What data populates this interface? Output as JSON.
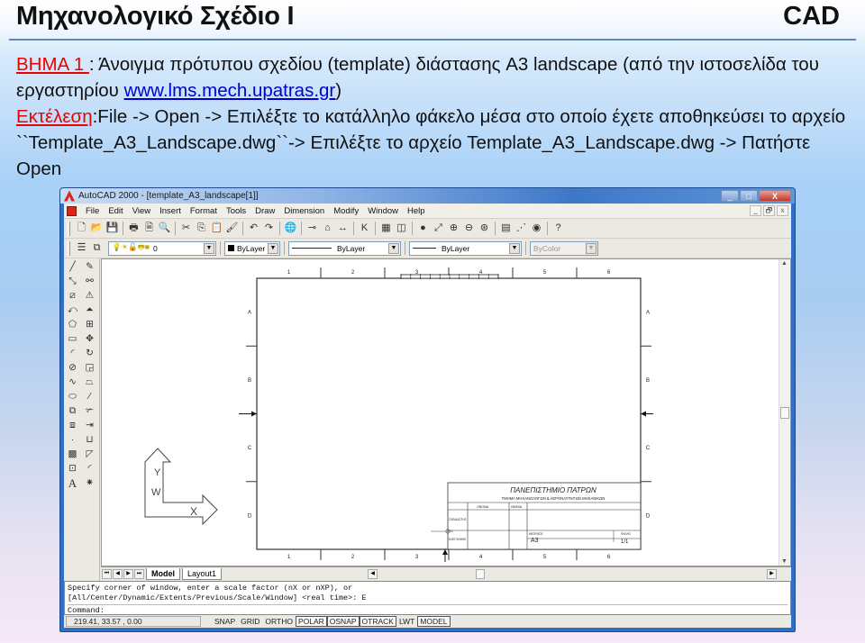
{
  "slide": {
    "title": "Μηχανολογικό Σχέδιο  Ι",
    "tag": "CAD",
    "step_label": "ΒΗΜΑ 1 ",
    "step_text": ": Άνοιγμα πρότυπου σχεδίου (template) διάστασης A3 landscape (από την ιστοσελίδα του εργαστηρίου ",
    "link": "www.lms.mech.upatras.gr",
    "step_close": ")",
    "exec_label": "Εκτέλεση",
    "exec_text": ":File -> Open -> Επιλέξτε το κατάλληλο φάκελο μέσα στο οποίο έχετε αποθηκεύσει το αρχείο ``Template_A3_Landscape.dwg``-> Επιλέξτε το αρχείο Template_A3_Landscape.dwg  -> Πατήστε  Open"
  },
  "window": {
    "title": "AutoCAD 2000 - [template_A3_landscape[1]]",
    "controls": {
      "minimize": "_",
      "maximize": "□",
      "close": "X"
    },
    "doc_controls": {
      "minimize": "_",
      "restore": "🗗",
      "close": "x"
    }
  },
  "menu": [
    "File",
    "Edit",
    "View",
    "Insert",
    "Format",
    "Tools",
    "Draw",
    "Dimension",
    "Modify",
    "Window",
    "Help"
  ],
  "standard_toolbar": [
    {
      "icon": "new-icon",
      "glyph": "🗋"
    },
    {
      "icon": "open-icon",
      "glyph": "📂"
    },
    {
      "icon": "save-icon",
      "glyph": "💾"
    },
    {
      "sep": true
    },
    {
      "icon": "print-icon",
      "glyph": "🖶"
    },
    {
      "icon": "print-preview-icon",
      "glyph": "🗎"
    },
    {
      "icon": "find-icon",
      "glyph": "🔍"
    },
    {
      "sep": true
    },
    {
      "icon": "cut-icon",
      "glyph": "✂"
    },
    {
      "icon": "copy-icon",
      "glyph": "⎘"
    },
    {
      "icon": "paste-icon",
      "glyph": "📋"
    },
    {
      "icon": "match-properties-icon",
      "glyph": "🖌"
    },
    {
      "sep": true
    },
    {
      "icon": "undo-icon",
      "glyph": "↶"
    },
    {
      "icon": "redo-icon",
      "glyph": "↷"
    },
    {
      "sep": true
    },
    {
      "icon": "web-icon",
      "glyph": "🌐"
    },
    {
      "sep": true
    },
    {
      "icon": "object-snap-icon",
      "glyph": "⊸"
    },
    {
      "icon": "ucs-icon",
      "glyph": "⌂"
    },
    {
      "icon": "distance-icon",
      "glyph": "↔"
    },
    {
      "sep": true
    },
    {
      "icon": "inquiry-icon",
      "glyph": "K"
    },
    {
      "sep": true
    },
    {
      "icon": "named-views-icon",
      "glyph": "▦"
    },
    {
      "icon": "viewports-icon",
      "glyph": "◫"
    },
    {
      "sep": true
    },
    {
      "icon": "pan-icon",
      "glyph": "●"
    },
    {
      "icon": "zoom-realtime-icon",
      "glyph": "⤢"
    },
    {
      "icon": "zoom-window-icon",
      "glyph": "⊕"
    },
    {
      "icon": "zoom-previous-icon",
      "glyph": "⊖"
    },
    {
      "icon": "zoom-extents-icon",
      "glyph": "⊛"
    },
    {
      "sep": true
    },
    {
      "icon": "properties-icon",
      "glyph": "▤"
    },
    {
      "icon": "design-center-icon",
      "glyph": "⋰"
    },
    {
      "icon": "dbconnect-icon",
      "glyph": "◉"
    },
    {
      "sep": true
    },
    {
      "icon": "help-icon",
      "glyph": "?"
    }
  ],
  "properties_toolbar": {
    "layer_value": "0",
    "color_value": "ByLayer",
    "linetype_value": "ByLayer",
    "lineweight_value": "ByLayer",
    "plotstyle_value": "ByColor"
  },
  "draw_tools": [
    {
      "icon": "line-icon",
      "glyph": "╱"
    },
    {
      "icon": "erase-icon",
      "glyph": "✎"
    },
    {
      "icon": "construction-line-icon",
      "glyph": "⤡"
    },
    {
      "icon": "copy-object-icon",
      "glyph": "⚯"
    },
    {
      "icon": "multiline-icon",
      "glyph": "⧄"
    },
    {
      "icon": "mirror-icon",
      "glyph": "⚠"
    },
    {
      "icon": "polyline-icon",
      "glyph": "⤺"
    },
    {
      "icon": "offset-icon",
      "glyph": "⏶"
    },
    {
      "icon": "polygon-icon",
      "glyph": "⬠"
    },
    {
      "icon": "array-icon",
      "glyph": "⊞"
    },
    {
      "icon": "rectangle-icon",
      "glyph": "▭"
    },
    {
      "icon": "move-icon",
      "glyph": "✥"
    },
    {
      "icon": "arc-icon",
      "glyph": "◜"
    },
    {
      "icon": "rotate-icon",
      "glyph": "↻"
    },
    {
      "icon": "circle-icon",
      "glyph": "⊘"
    },
    {
      "icon": "scale-icon",
      "glyph": "◲"
    },
    {
      "icon": "spline-icon",
      "glyph": "∿"
    },
    {
      "icon": "stretch-icon",
      "glyph": "⏢"
    },
    {
      "icon": "ellipse-icon",
      "glyph": "⬭"
    },
    {
      "icon": "lengthen-icon",
      "glyph": "⁄"
    },
    {
      "icon": "insert-block-icon",
      "glyph": "⧉"
    },
    {
      "icon": "trim-icon",
      "glyph": "✃"
    },
    {
      "icon": "make-block-icon",
      "glyph": "⧈"
    },
    {
      "icon": "extend-icon",
      "glyph": "⇥"
    },
    {
      "icon": "point-icon",
      "glyph": "·"
    },
    {
      "icon": "break-icon",
      "glyph": "⊔"
    },
    {
      "icon": "hatch-icon",
      "glyph": "▩"
    },
    {
      "icon": "chamfer-icon",
      "glyph": "◸"
    },
    {
      "icon": "region-icon",
      "glyph": "⊡"
    },
    {
      "icon": "fillet-icon",
      "glyph": "◜"
    },
    {
      "icon": "multiline-text-icon",
      "glyph": "A"
    },
    {
      "icon": "explode-icon",
      "glyph": "✷"
    }
  ],
  "drawing": {
    "col_labels": [
      "1",
      "2",
      "3",
      "4",
      "5",
      "6"
    ],
    "row_labels": [
      "A",
      "B",
      "C",
      "D"
    ],
    "title_block": {
      "university": "ΠΑΝΕΠΙΣΤΗΜΙΟ  ΠΑΤΡΩΝ",
      "department": "ΤΜΗΜΑ ΜΗΧΑΝΟΛΟΓΩΝ & ΑΕΡΟΝΑΥΠΗΓΩΝ ΜΗΧΑΝΙΚΩΝ",
      "field_name": "ΟΝΟΜΑ",
      "field_date": "ΗΜ/ΝΙΑ",
      "field_drawn": "ΣΧΕΔΙΑΣΤΗΣ",
      "field_checked": "ΕΛΕΓΧΘΗΚΕ",
      "format_label": "ΜΕΓΕΘΟΣ",
      "format_value": "A3",
      "sheet_label": "ΦΥΛΛΟ",
      "sheet_value": "1/1",
      "dash": "—"
    }
  },
  "tabs": [
    {
      "label": "Model",
      "active": true
    },
    {
      "label": "Layout1",
      "active": false
    }
  ],
  "command": {
    "line1": "Specify corner of window, enter a scale factor (nX or nXP), or",
    "line2": "[All/Center/Dynamic/Extents/Previous/Scale/Window] <real time>: E",
    "prompt": "Command:"
  },
  "status": {
    "coordinates": "219.41,  33.57 , 0.00",
    "modes": [
      {
        "label": "SNAP",
        "on": false
      },
      {
        "label": "GRID",
        "on": false
      },
      {
        "label": "ORTHO",
        "on": false
      },
      {
        "label": "POLAR",
        "on": true
      },
      {
        "label": "OSNAP",
        "on": true
      },
      {
        "label": "OTRACK",
        "on": true
      },
      {
        "label": "LWT",
        "on": false
      },
      {
        "label": "MODEL",
        "on": true
      }
    ]
  }
}
